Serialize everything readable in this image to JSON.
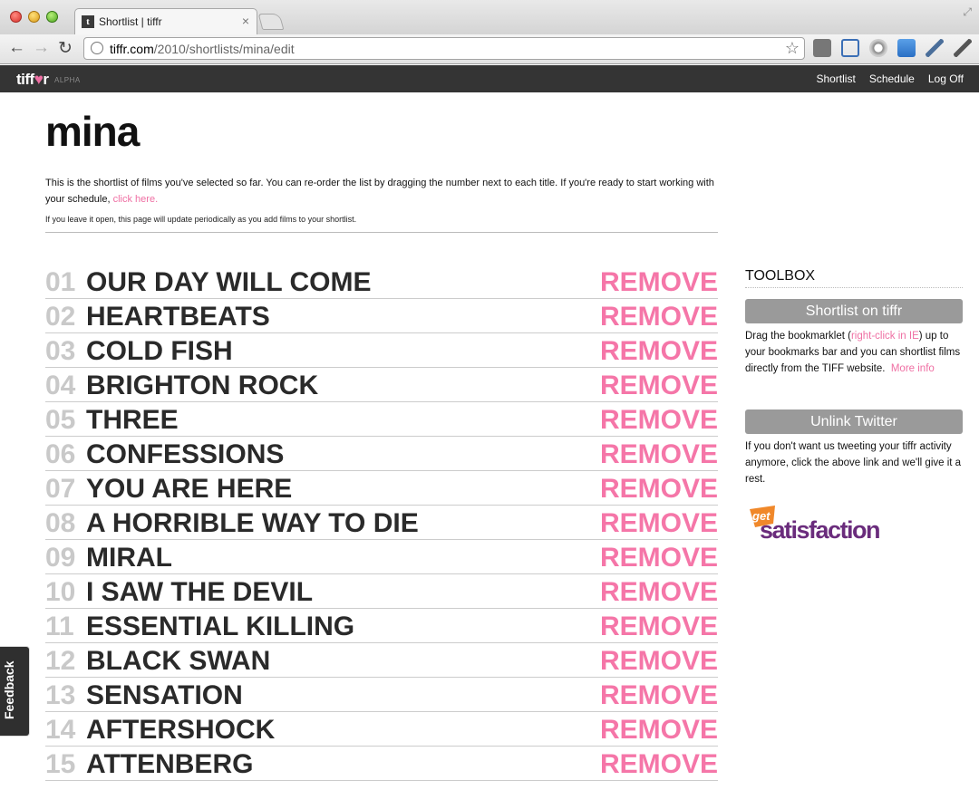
{
  "browser": {
    "tab_title": "Shortlist | tiffr",
    "url_host": "tiffr.com",
    "url_path": "/2010/shortlists/mina/edit"
  },
  "site": {
    "logo": "tiffr",
    "alpha": "ALPHA",
    "nav": [
      "Shortlist",
      "Schedule",
      "Log Off"
    ]
  },
  "page": {
    "title": "mina",
    "intro": "This is the shortlist of films you've selected so far. You can re-order the list by dragging the number next to each title. If you're ready to start working with your schedule, ",
    "intro_link": "click here.",
    "note": "If you leave it open, this page will update periodically as you add films to your shortlist."
  },
  "films": [
    {
      "num": "01",
      "title": "OUR DAY WILL COME",
      "action": "REMOVE"
    },
    {
      "num": "02",
      "title": "HEARTBEATS",
      "action": "REMOVE"
    },
    {
      "num": "03",
      "title": "COLD FISH",
      "action": "REMOVE"
    },
    {
      "num": "04",
      "title": "BRIGHTON ROCK",
      "action": "REMOVE"
    },
    {
      "num": "05",
      "title": "THREE",
      "action": "REMOVE"
    },
    {
      "num": "06",
      "title": "CONFESSIONS",
      "action": "REMOVE"
    },
    {
      "num": "07",
      "title": "YOU ARE HERE",
      "action": "REMOVE"
    },
    {
      "num": "08",
      "title": "A HORRIBLE WAY TO DIE",
      "action": "REMOVE"
    },
    {
      "num": "09",
      "title": "MIRAL",
      "action": "REMOVE"
    },
    {
      "num": "10",
      "title": "I SAW THE DEVIL",
      "action": "REMOVE"
    },
    {
      "num": "11",
      "title": "ESSENTIAL KILLING",
      "action": "REMOVE"
    },
    {
      "num": "12",
      "title": "BLACK SWAN",
      "action": "REMOVE"
    },
    {
      "num": "13",
      "title": "SENSATION",
      "action": "REMOVE"
    },
    {
      "num": "14",
      "title": "AFTERSHOCK",
      "action": "REMOVE"
    },
    {
      "num": "15",
      "title": "ATTENBERG",
      "action": "REMOVE"
    }
  ],
  "toolbox": {
    "title": "TOOLBOX",
    "shortlist_button": "Shortlist on tiffr",
    "shortlist_text_before": "Drag the bookmarklet (",
    "shortlist_link_ie": "right-click in IE",
    "shortlist_text_after": ") up to your bookmarks bar and you can shortlist films directly from the TIFF website.",
    "more_info": "More info",
    "unlink_button": "Unlink Twitter",
    "unlink_text": "If you don't want us tweeting your tiffr activity anymore, click the above link and we'll give it a rest."
  },
  "getsatisfaction": {
    "get": "get",
    "word": "satisfaction"
  },
  "feedback": "Feedback",
  "colors": {
    "accent": "#ef6fa3",
    "header": "#343434",
    "num_gray": "#c9c9c9"
  }
}
